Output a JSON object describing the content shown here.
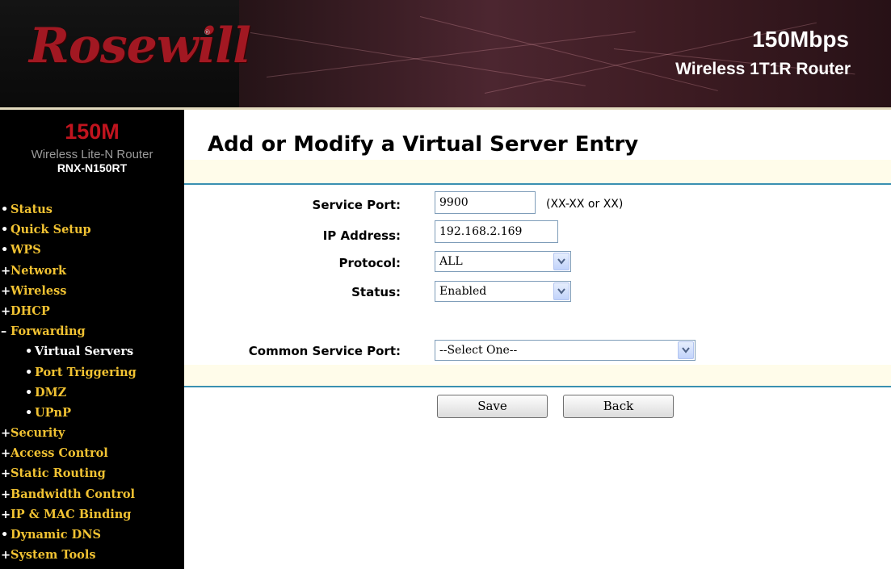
{
  "header": {
    "brand": "Rosewill",
    "brand_mark": "®",
    "title_line1": "150Mbps",
    "title_line2": "Wireless 1T1R Router"
  },
  "sidebar": {
    "model_big": "150M",
    "model_line": "Wireless Lite-N Router",
    "model_code": "RNX-N150RT",
    "items": [
      {
        "marker": "•",
        "label": "Status",
        "level": "top"
      },
      {
        "marker": "•",
        "label": "Quick Setup",
        "level": "top"
      },
      {
        "marker": "•",
        "label": "WPS",
        "level": "top"
      },
      {
        "marker": "+",
        "label": "Network",
        "level": "top"
      },
      {
        "marker": "+",
        "label": "Wireless",
        "level": "top"
      },
      {
        "marker": "+",
        "label": "DHCP",
        "level": "top"
      },
      {
        "marker": "–",
        "label": "Forwarding",
        "level": "top"
      },
      {
        "marker": "•",
        "label": "Virtual Servers",
        "level": "sub",
        "active": true
      },
      {
        "marker": "•",
        "label": "Port Triggering",
        "level": "sub"
      },
      {
        "marker": "•",
        "label": "DMZ",
        "level": "sub"
      },
      {
        "marker": "•",
        "label": "UPnP",
        "level": "sub"
      },
      {
        "marker": "+",
        "label": "Security",
        "level": "top"
      },
      {
        "marker": "+",
        "label": "Access Control",
        "level": "top"
      },
      {
        "marker": "+",
        "label": "Static Routing",
        "level": "top"
      },
      {
        "marker": "+",
        "label": "Bandwidth Control",
        "level": "top"
      },
      {
        "marker": "+",
        "label": "IP & MAC Binding",
        "level": "top"
      },
      {
        "marker": "•",
        "label": "Dynamic DNS",
        "level": "top"
      },
      {
        "marker": "+",
        "label": "System Tools",
        "level": "top"
      }
    ]
  },
  "main": {
    "title": "Add or Modify a Virtual Server Entry",
    "service_port": {
      "label": "Service Port:",
      "value": "9900",
      "hint": "(XX-XX or XX)"
    },
    "ip_address": {
      "label": "IP Address:",
      "value": "192.168.2.169"
    },
    "protocol": {
      "label": "Protocol:",
      "selected": "ALL"
    },
    "status": {
      "label": "Status:",
      "selected": "Enabled"
    },
    "common_service_port": {
      "label": "Common Service Port:",
      "selected": "--Select One--"
    },
    "save_label": "Save",
    "back_label": "Back"
  },
  "colors": {
    "brand_red": "#a21822",
    "menu_yellow": "#f1c232",
    "rule_blue": "#3a90b1",
    "band_cream": "#fffcea"
  }
}
